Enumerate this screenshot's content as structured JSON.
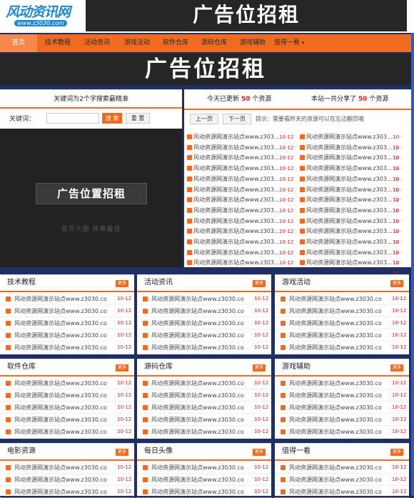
{
  "site": {
    "logo_text": "风动资讯网",
    "logo_url": "www.z3030.com"
  },
  "top_ad": "广告位招租",
  "nav": {
    "items": [
      "首页",
      "技术教程",
      "活动资讯",
      "游戏活动",
      "软件仓库",
      "源码仓库",
      "游戏辅助",
      "值得一看"
    ]
  },
  "big_ad": "广告位招租",
  "search": {
    "title": "关键词为2个字搜索最精准",
    "label": "关键词：",
    "placeholder": "",
    "search_button": "搜 索",
    "reset_button": "重 置"
  },
  "ad_box": {
    "main": "广告位置招租",
    "sub": "首页大图 效果最佳"
  },
  "stats": {
    "today_prefix": "今天已更新",
    "today_count": "50",
    "today_suffix": "个资源",
    "total_prefix": "本站一共分享了",
    "total_count": "50",
    "total_suffix": "个资源",
    "prev_button": "上一页",
    "next_button": "下一页",
    "tip": "提示：需要看昨天的资源可以在左边翻页哦"
  },
  "updates": {
    "left": [
      {
        "title": "风动资源网演示站点www.z303...",
        "date": "10-12"
      },
      {
        "title": "风动资源网演示站点www.z303...",
        "date": "10-12"
      },
      {
        "title": "风动资源网演示站点www.z303...",
        "date": "10-12"
      },
      {
        "title": "风动资源网演示站点www.z303...",
        "date": "10-12"
      },
      {
        "title": "风动资源网演示站点www.z303...",
        "date": "10-12"
      },
      {
        "title": "风动资源网演示站点www.z303...",
        "date": "10-12"
      },
      {
        "title": "风动资源网演示站点www.z303...",
        "date": "10-12"
      },
      {
        "title": "风动资源网演示站点www.z303...",
        "date": "10-12"
      },
      {
        "title": "风动资源网演示站点www.z303...",
        "date": "10-12"
      },
      {
        "title": "风动资源网演示站点www.z303...",
        "date": "10-12"
      },
      {
        "title": "风动资源网演示站点www.z303...",
        "date": "10-12"
      },
      {
        "title": "风动资源网演示站点www.z303...",
        "date": "10-12"
      },
      {
        "title": "风动资源网演示站点www.z303...",
        "date": "10-12"
      }
    ],
    "right": [
      {
        "title": "风动资源网演示站点www.z303...",
        "date": "10-12"
      },
      {
        "title": "风动资源网演示站点www.z303...",
        "date": "10-12"
      },
      {
        "title": "风动资源网演示站点www.z303...",
        "date": "10-12"
      },
      {
        "title": "风动资源网演示站点www.z303...",
        "date": "10-12"
      },
      {
        "title": "风动资源网演示站点www.z303...",
        "date": "10-12"
      },
      {
        "title": "风动资源网演示站点www.z303...",
        "date": "10-12"
      },
      {
        "title": "风动资源网演示站点www.z303...",
        "date": "10-12"
      },
      {
        "title": "风动资源网演示站点www.z303...",
        "date": "10-12"
      },
      {
        "title": "风动资源网演示站点www.z303...",
        "date": "10-12"
      },
      {
        "title": "风动资源网演示站点www.z303...",
        "date": "10-12"
      },
      {
        "title": "风动资源网演示站点www.z303...",
        "date": "10-12"
      },
      {
        "title": "风动资源网演示站点www.z303...",
        "date": "10-12"
      },
      {
        "title": "风动资源网演示站点www.z303...",
        "date": "10-12"
      }
    ]
  },
  "sections": [
    {
      "title": "技术教程",
      "more": "更多",
      "items": [
        {
          "t": "风动资源网演示站点www.z3030.co",
          "d": "10-12"
        },
        {
          "t": "风动资源网演示站点www.z3030.co",
          "d": "10-12"
        },
        {
          "t": "风动资源网演示站点www.z3030.co",
          "d": "10-12"
        },
        {
          "t": "风动资源网演示站点www.z3030.co",
          "d": "10-12"
        },
        {
          "t": "风动资源网演示站点www.z3030.co",
          "d": "10-12"
        }
      ]
    },
    {
      "title": "活动资讯",
      "more": "更多",
      "items": [
        {
          "t": "风动资源网演示站点www.z3030.co",
          "d": "10-12"
        },
        {
          "t": "风动资源网演示站点www.z3030.co",
          "d": "10-12"
        },
        {
          "t": "风动资源网演示站点www.z3030.co",
          "d": "10-12"
        },
        {
          "t": "风动资源网演示站点www.z3030.co",
          "d": "10-12"
        },
        {
          "t": "风动资源网演示站点www.z3030.co",
          "d": "10-12"
        }
      ]
    },
    {
      "title": "游戏活动",
      "more": "更多",
      "items": [
        {
          "t": "风动资源网演示站点www.z3030.co",
          "d": "10-12"
        },
        {
          "t": "风动资源网演示站点www.z3030.co",
          "d": "10-12"
        },
        {
          "t": "风动资源网演示站点www.z3030.co",
          "d": "10-12"
        },
        {
          "t": "风动资源网演示站点www.z3030.co",
          "d": "10-12"
        },
        {
          "t": "风动资源网演示站点www.z3030.co",
          "d": "10-12"
        }
      ]
    },
    {
      "title": "软件仓库",
      "more": "更多",
      "items": [
        {
          "t": "风动资源网演示站点www.z3030.co",
          "d": "10-12"
        },
        {
          "t": "风动资源网演示站点www.z3030.co",
          "d": "10-12"
        },
        {
          "t": "风动资源网演示站点www.z3030.co",
          "d": "10-12"
        },
        {
          "t": "风动资源网演示站点www.z3030.co",
          "d": "10-12"
        },
        {
          "t": "风动资源网演示站点www.z3030.co",
          "d": "10-12"
        }
      ]
    },
    {
      "title": "源码仓库",
      "more": "更多",
      "items": [
        {
          "t": "风动资源网演示站点www.z3030.co",
          "d": "10-12"
        },
        {
          "t": "风动资源网演示站点www.z3030.co",
          "d": "10-12"
        },
        {
          "t": "风动资源网演示站点www.z3030.co",
          "d": "10-12"
        },
        {
          "t": "风动资源网演示站点www.z3030.co",
          "d": "10-12"
        },
        {
          "t": "风动资源网演示站点www.z3030.co",
          "d": "10-12"
        }
      ]
    },
    {
      "title": "游戏辅助",
      "more": "更多",
      "items": [
        {
          "t": "风动资源网演示站点www.z3030.co",
          "d": "10-12"
        },
        {
          "t": "风动资源网演示站点www.z3030.co",
          "d": "10-12"
        },
        {
          "t": "风动资源网演示站点www.z3030.co",
          "d": "10-12"
        },
        {
          "t": "风动资源网演示站点www.z3030.co",
          "d": "10-12"
        },
        {
          "t": "风动资源网演示站点www.z3030.co",
          "d": "10-12"
        }
      ]
    },
    {
      "title": "电影资源",
      "more": "更多",
      "items": [
        {
          "t": "风动资源网演示站点www.z3030.co",
          "d": "10-12"
        },
        {
          "t": "风动资源网演示站点www.z3030.co",
          "d": "10-12"
        },
        {
          "t": "风动资源网演示站点www.z3030.co",
          "d": "10-12"
        }
      ]
    },
    {
      "title": "每日头像",
      "more": "更多",
      "items": [
        {
          "t": "风动资源网演示站点www.z3030.co",
          "d": "10-12"
        },
        {
          "t": "风动资源网演示站点www.z3030.co",
          "d": "10-12"
        },
        {
          "t": "风动资源网演示站点www.z3030.co",
          "d": "10-12"
        }
      ]
    },
    {
      "title": "值得一看",
      "more": "更多",
      "items": [
        {
          "t": "风动资源网演示站点www.z3030.co",
          "d": "10-12"
        },
        {
          "t": "风动资源网演示站点www.z3030.co",
          "d": "10-12"
        },
        {
          "t": "风动资源网演示站点www.z3030.co",
          "d": "10-12"
        }
      ]
    }
  ],
  "colors": {
    "accent": "#f06b1f",
    "date": "#e01c1c",
    "page_bg": "#1f2f63"
  }
}
